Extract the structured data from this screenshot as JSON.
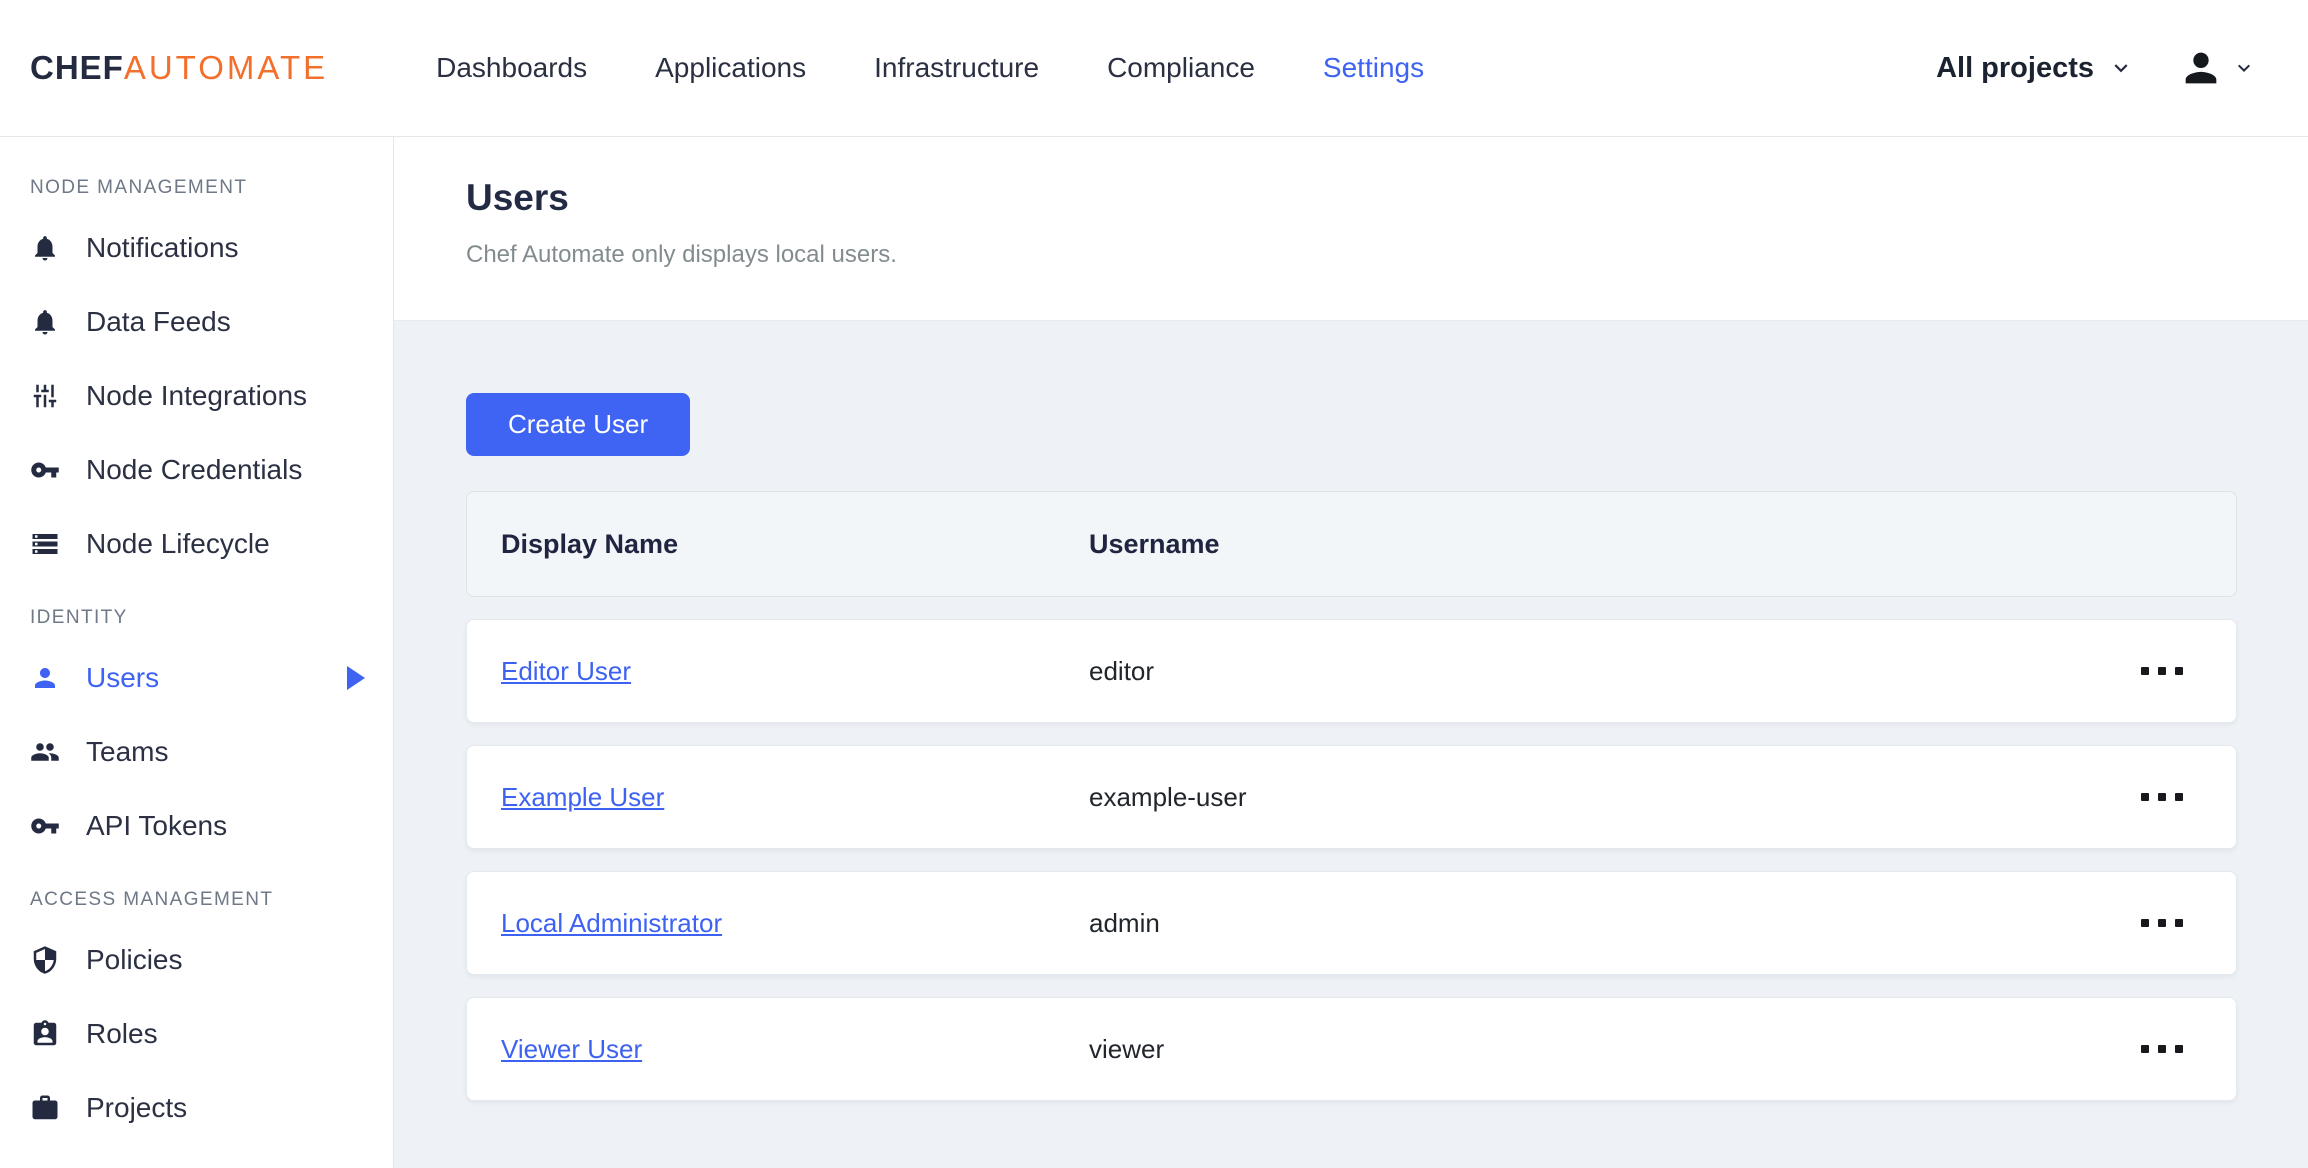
{
  "brand": {
    "chef": "CHEF",
    "automate": "AUTOMATE"
  },
  "nav": {
    "items": [
      {
        "label": "Dashboards",
        "active": false
      },
      {
        "label": "Applications",
        "active": false
      },
      {
        "label": "Infrastructure",
        "active": false
      },
      {
        "label": "Compliance",
        "active": false
      },
      {
        "label": "Settings",
        "active": true
      }
    ]
  },
  "projects_filter": {
    "label": "All projects",
    "icon": "chevron-down-icon"
  },
  "user_menu": {
    "icon": "person-icon",
    "chevron": "chevron-down-icon"
  },
  "sidebar": {
    "sections": [
      {
        "heading": "NODE MANAGEMENT",
        "items": [
          {
            "label": "Notifications",
            "icon": "bell-icon",
            "active": false
          },
          {
            "label": "Data Feeds",
            "icon": "bell-icon",
            "active": false
          },
          {
            "label": "Node Integrations",
            "icon": "sliders-icon",
            "active": false
          },
          {
            "label": "Node Credentials",
            "icon": "key-icon",
            "active": false
          },
          {
            "label": "Node Lifecycle",
            "icon": "server-icon",
            "active": false
          }
        ]
      },
      {
        "heading": "IDENTITY",
        "items": [
          {
            "label": "Users",
            "icon": "person-icon",
            "active": true
          },
          {
            "label": "Teams",
            "icon": "people-icon",
            "active": false
          },
          {
            "label": "API Tokens",
            "icon": "key-icon",
            "active": false
          }
        ]
      },
      {
        "heading": "ACCESS MANAGEMENT",
        "items": [
          {
            "label": "Policies",
            "icon": "shield-icon",
            "active": false
          },
          {
            "label": "Roles",
            "icon": "id-badge-icon",
            "active": false
          },
          {
            "label": "Projects",
            "icon": "briefcase-icon",
            "active": false
          }
        ]
      }
    ]
  },
  "page": {
    "title": "Users",
    "subtitle": "Chef Automate only displays local users."
  },
  "toolbar": {
    "create_button": "Create User"
  },
  "table": {
    "columns": [
      "Display Name",
      "Username"
    ],
    "rows": [
      {
        "display_name": "Editor User",
        "username": "editor"
      },
      {
        "display_name": "Example User",
        "username": "example-user"
      },
      {
        "display_name": "Local Administrator",
        "username": "admin"
      },
      {
        "display_name": "Viewer User",
        "username": "viewer"
      }
    ],
    "row_action_icon": "ellipsis-icon"
  },
  "colors": {
    "accent_blue": "#3e62f2",
    "brand_orange": "#f3702c",
    "dark_navy": "#242b40",
    "content_bg": "#eef2f6",
    "link_blue": "#3d62f2"
  }
}
